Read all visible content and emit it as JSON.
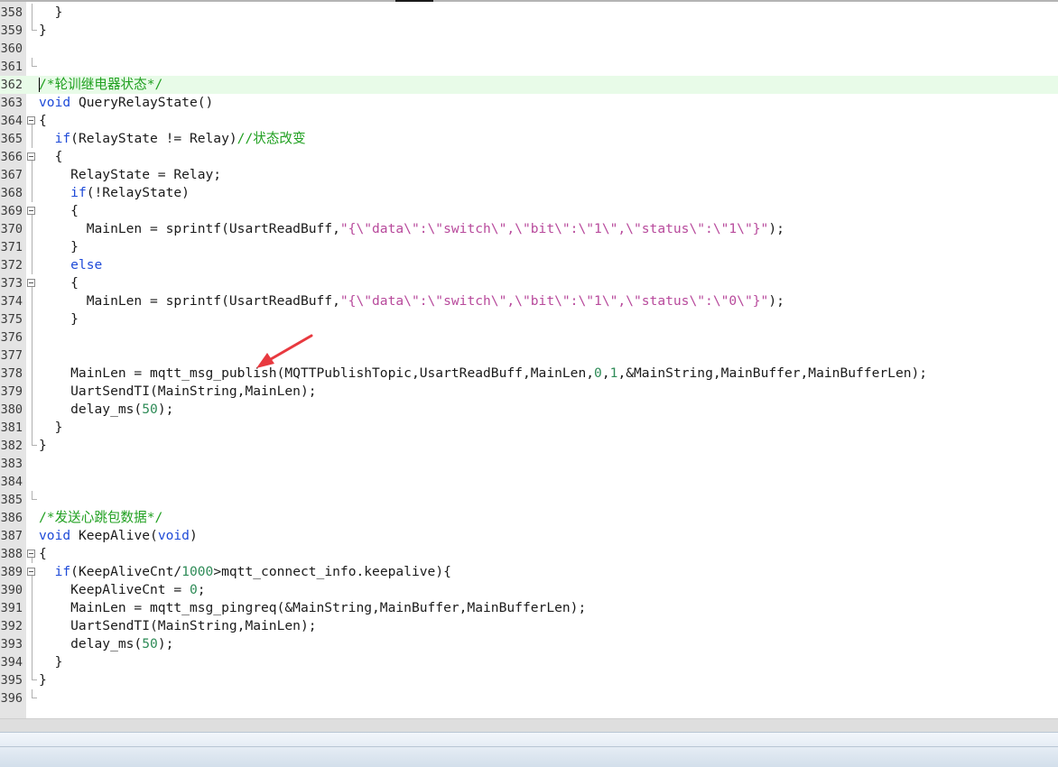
{
  "editor": {
    "lines": [
      {
        "num": "358",
        "fold": "mid",
        "tokens": [
          {
            "t": "  }",
            "c": ""
          }
        ]
      },
      {
        "num": "359",
        "fold": "end",
        "tokens": [
          {
            "t": "}",
            "c": ""
          }
        ]
      },
      {
        "num": "360",
        "fold": "",
        "tokens": []
      },
      {
        "num": "361",
        "fold": "end",
        "tokens": []
      },
      {
        "num": "362",
        "fold": "",
        "current": true,
        "tokens": [
          {
            "t": "/*轮训继电器状态*/",
            "c": "cm"
          }
        ]
      },
      {
        "num": "363",
        "fold": "",
        "tokens": [
          {
            "t": "void",
            "c": "kw"
          },
          {
            "t": " QueryRelayState()",
            "c": ""
          }
        ]
      },
      {
        "num": "364",
        "fold": "open",
        "tokens": [
          {
            "t": "{",
            "c": ""
          }
        ]
      },
      {
        "num": "365",
        "fold": "mid",
        "tokens": [
          {
            "t": "  ",
            "c": ""
          },
          {
            "t": "if",
            "c": "kw"
          },
          {
            "t": "(RelayState != Relay)",
            "c": ""
          },
          {
            "t": "//状态改变",
            "c": "cm"
          }
        ]
      },
      {
        "num": "366",
        "fold": "open",
        "tokens": [
          {
            "t": "  {",
            "c": ""
          }
        ]
      },
      {
        "num": "367",
        "fold": "mid",
        "tokens": [
          {
            "t": "    RelayState = Relay;",
            "c": ""
          }
        ]
      },
      {
        "num": "368",
        "fold": "mid",
        "tokens": [
          {
            "t": "    ",
            "c": ""
          },
          {
            "t": "if",
            "c": "kw"
          },
          {
            "t": "(!RelayState)",
            "c": ""
          }
        ]
      },
      {
        "num": "369",
        "fold": "open",
        "tokens": [
          {
            "t": "    {",
            "c": ""
          }
        ]
      },
      {
        "num": "370",
        "fold": "mid",
        "tokens": [
          {
            "t": "      MainLen = sprintf(UsartReadBuff,",
            "c": ""
          },
          {
            "t": "\"{\\\"data\\\":\\\"switch\\\",\\\"bit\\\":\\\"1\\\",\\\"status\\\":\\\"1\\\"}\"",
            "c": "str"
          },
          {
            "t": ");",
            "c": ""
          }
        ]
      },
      {
        "num": "371",
        "fold": "mid",
        "tokens": [
          {
            "t": "    }",
            "c": ""
          }
        ]
      },
      {
        "num": "372",
        "fold": "mid",
        "tokens": [
          {
            "t": "    ",
            "c": ""
          },
          {
            "t": "else",
            "c": "kw"
          }
        ]
      },
      {
        "num": "373",
        "fold": "open",
        "tokens": [
          {
            "t": "    {",
            "c": ""
          }
        ]
      },
      {
        "num": "374",
        "fold": "mid",
        "tokens": [
          {
            "t": "      MainLen = sprintf(UsartReadBuff,",
            "c": ""
          },
          {
            "t": "\"{\\\"data\\\":\\\"switch\\\",\\\"bit\\\":\\\"1\\\",\\\"status\\\":\\\"0\\\"}\"",
            "c": "str"
          },
          {
            "t": ");",
            "c": ""
          }
        ]
      },
      {
        "num": "375",
        "fold": "mid",
        "tokens": [
          {
            "t": "    }",
            "c": ""
          }
        ]
      },
      {
        "num": "376",
        "fold": "mid",
        "tokens": []
      },
      {
        "num": "377",
        "fold": "mid",
        "tokens": []
      },
      {
        "num": "378",
        "fold": "mid",
        "tokens": [
          {
            "t": "    MainLen = mqtt_msg_publish(MQTTPublishTopic,UsartReadBuff,MainLen,",
            "c": ""
          },
          {
            "t": "0",
            "c": "num"
          },
          {
            "t": ",",
            "c": ""
          },
          {
            "t": "1",
            "c": "num"
          },
          {
            "t": ",&MainString,MainBuffer,MainBufferLen);",
            "c": ""
          }
        ]
      },
      {
        "num": "379",
        "fold": "mid",
        "tokens": [
          {
            "t": "    UartSendTI(MainString,MainLen);",
            "c": ""
          }
        ]
      },
      {
        "num": "380",
        "fold": "mid",
        "tokens": [
          {
            "t": "    delay_ms(",
            "c": ""
          },
          {
            "t": "50",
            "c": "num"
          },
          {
            "t": ");",
            "c": ""
          }
        ]
      },
      {
        "num": "381",
        "fold": "mid",
        "tokens": [
          {
            "t": "  }",
            "c": ""
          }
        ]
      },
      {
        "num": "382",
        "fold": "end",
        "tokens": [
          {
            "t": "}",
            "c": ""
          }
        ]
      },
      {
        "num": "383",
        "fold": "",
        "tokens": []
      },
      {
        "num": "384",
        "fold": "",
        "tokens": []
      },
      {
        "num": "385",
        "fold": "end",
        "tokens": []
      },
      {
        "num": "386",
        "fold": "",
        "tokens": [
          {
            "t": "/*发送心跳包数据*/",
            "c": "cm"
          }
        ]
      },
      {
        "num": "387",
        "fold": "",
        "tokens": [
          {
            "t": "void",
            "c": "kw"
          },
          {
            "t": " KeepAlive(",
            "c": ""
          },
          {
            "t": "void",
            "c": "kw"
          },
          {
            "t": ")",
            "c": ""
          }
        ]
      },
      {
        "num": "388",
        "fold": "open",
        "tokens": [
          {
            "t": "{",
            "c": ""
          }
        ]
      },
      {
        "num": "389",
        "fold": "open",
        "tokens": [
          {
            "t": "  ",
            "c": ""
          },
          {
            "t": "if",
            "c": "kw"
          },
          {
            "t": "(KeepAliveCnt/",
            "c": ""
          },
          {
            "t": "1000",
            "c": "num"
          },
          {
            "t": ">mqtt_connect_info.keepalive){",
            "c": ""
          }
        ]
      },
      {
        "num": "390",
        "fold": "mid",
        "tokens": [
          {
            "t": "    KeepAliveCnt = ",
            "c": ""
          },
          {
            "t": "0",
            "c": "num"
          },
          {
            "t": ";",
            "c": ""
          }
        ]
      },
      {
        "num": "391",
        "fold": "mid",
        "tokens": [
          {
            "t": "    MainLen = mqtt_msg_pingreq(&MainString,MainBuffer,MainBufferLen);",
            "c": ""
          }
        ]
      },
      {
        "num": "392",
        "fold": "mid",
        "tokens": [
          {
            "t": "    UartSendTI(MainString,MainLen);",
            "c": ""
          }
        ]
      },
      {
        "num": "393",
        "fold": "mid",
        "tokens": [
          {
            "t": "    delay_ms(",
            "c": ""
          },
          {
            "t": "50",
            "c": "num"
          },
          {
            "t": ");",
            "c": ""
          }
        ]
      },
      {
        "num": "394",
        "fold": "mid",
        "tokens": [
          {
            "t": "  }",
            "c": ""
          }
        ]
      },
      {
        "num": "395",
        "fold": "end",
        "tokens": [
          {
            "t": "}",
            "c": ""
          }
        ]
      },
      {
        "num": "396",
        "fold": "end",
        "tokens": []
      }
    ]
  },
  "colors": {
    "keyword": "#1f4bd8",
    "number": "#2e8b57",
    "string": "#b84a9c",
    "comment": "#20a020",
    "current_line": "#e8fbe8",
    "annotation_arrow": "#e8393f"
  },
  "annotation": {
    "icon": "red-arrow-icon"
  }
}
